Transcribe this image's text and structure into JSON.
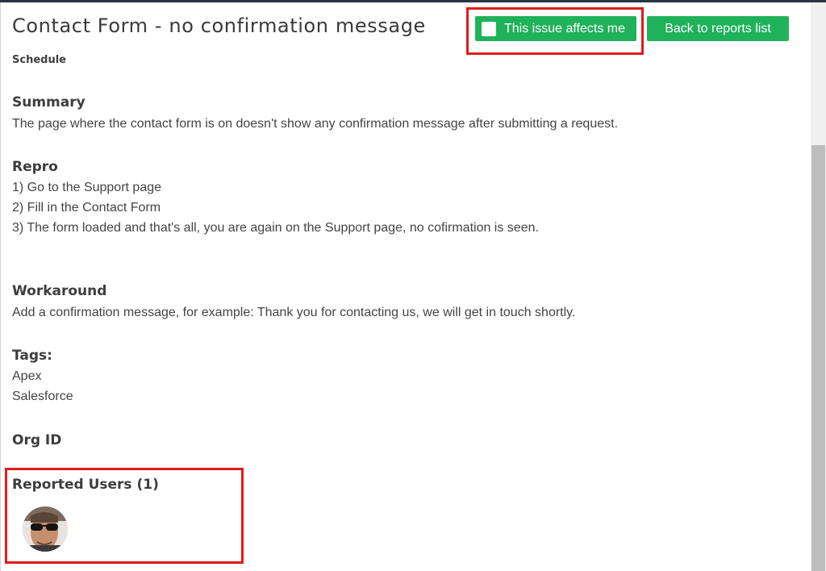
{
  "report": {
    "title": "Contact Form - no confirmation message",
    "subtitle": "Schedule",
    "affects_button": {
      "label": "This issue affects me",
      "checked": false
    },
    "back_button": {
      "label": "Back to reports list"
    }
  },
  "sections": {
    "summary": {
      "heading": "Summary",
      "text": "The page where the contact form is on doesn't show any confirmation message after submitting a request."
    },
    "repro": {
      "heading": "Repro",
      "steps": [
        "1) Go to the Support page",
        "2) Fill in the Contact Form",
        "3) The form loaded and that's all, you are again on the Support page, no cofirmation is seen."
      ]
    },
    "workaround": {
      "heading": "Workaround",
      "text": "Add a confirmation message, for example: Thank you for contacting us, we will get in touch shortly."
    },
    "tags": {
      "heading": "Tags:",
      "items": [
        "Apex",
        "Salesforce"
      ]
    },
    "org_id": {
      "heading": "Org ID"
    },
    "reported_users": {
      "heading": "Reported Users (1)"
    }
  },
  "colors": {
    "button_green": "#1fb25a",
    "highlight_red": "#e01b1b",
    "top_bar": "#2b3443"
  },
  "icons": [
    "checkbox-icon",
    "user-avatar"
  ]
}
